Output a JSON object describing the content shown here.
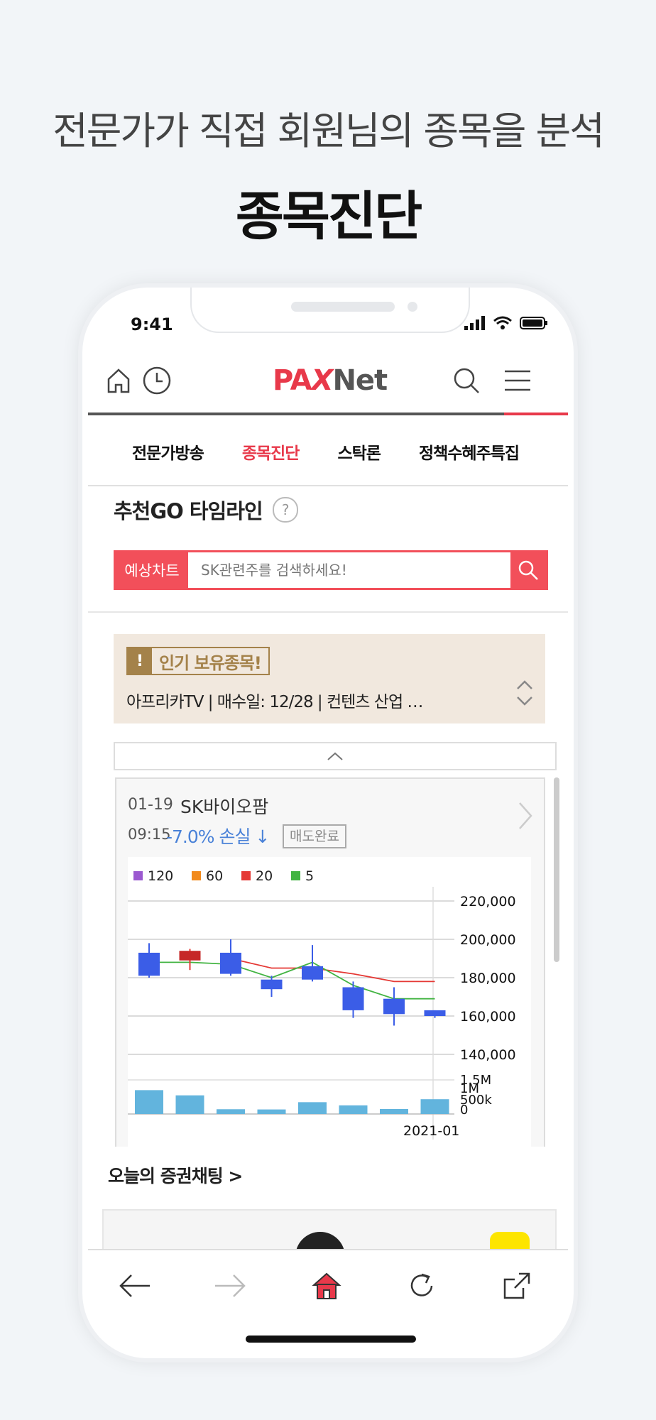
{
  "promo": {
    "headline": "전문가가 직접 회원님의 종목을 분석",
    "title": "종목진단"
  },
  "status": {
    "time": "9:41"
  },
  "header": {
    "logo_pa": "PA",
    "logo_x": "X",
    "logo_net": "Net"
  },
  "tabs": [
    {
      "label": "전문가방송"
    },
    {
      "label": "종목진단"
    },
    {
      "label": "스탁론"
    },
    {
      "label": "정책수혜주특집"
    }
  ],
  "section": {
    "title": "추천GO 타임라인",
    "help": "?"
  },
  "search": {
    "label": "예상차트",
    "placeholder": "SK관련주를 검색하세요!"
  },
  "popular": {
    "badge_mark": "!",
    "badge_title": "인기 보유종목!",
    "info": "아프리카TV  |  매수일: 12/28  |  컨텐츠 산업 …"
  },
  "card": {
    "date": "01-19",
    "name": "SK바이오팜",
    "time": "09:15",
    "change": "-7.0% 손실 ↓",
    "status": "매도완료"
  },
  "chart_data": {
    "type": "candlestick",
    "legend": [
      "120",
      "60",
      "20",
      "5"
    ],
    "legend_colors": [
      "#9b59d0",
      "#f28a1c",
      "#e53935",
      "#43b443"
    ],
    "candles": [
      {
        "open": 193000,
        "close": 181000,
        "high": 198000,
        "low": 180000
      },
      {
        "open": 189000,
        "close": 194000,
        "high": 195000,
        "low": 184000
      },
      {
        "open": 193000,
        "close": 182000,
        "high": 200000,
        "low": 181000
      },
      {
        "open": 179000,
        "close": 174000,
        "high": 181000,
        "low": 170000
      },
      {
        "open": 186000,
        "close": 179000,
        "high": 197000,
        "low": 178000
      },
      {
        "open": 175000,
        "close": 163000,
        "high": 178000,
        "low": 159000
      },
      {
        "open": 169000,
        "close": 161000,
        "high": 175000,
        "low": 155000
      },
      {
        "open": 163000,
        "close": 160000,
        "high": 163000,
        "low": 159000
      }
    ],
    "ma5": [
      188000,
      188000,
      187000,
      180000,
      188000,
      176000,
      169000,
      169000
    ],
    "ma20": [
      null,
      null,
      190000,
      185000,
      185000,
      182000,
      178000,
      178000
    ],
    "volume": [
      1050000,
      820000,
      210000,
      200000,
      520000,
      380000,
      220000,
      650000
    ],
    "y_ticks": [
      "220,000",
      "200,000",
      "180,000",
      "160,000",
      "140,000"
    ],
    "ylim": [
      140000,
      220000
    ],
    "vol_ticks": [
      "1.5M",
      "1M",
      "500k",
      "0"
    ],
    "vol_max": 1500000,
    "x_label": "2021-01"
  },
  "chat": {
    "title": "오늘의 증권채팅 >"
  }
}
